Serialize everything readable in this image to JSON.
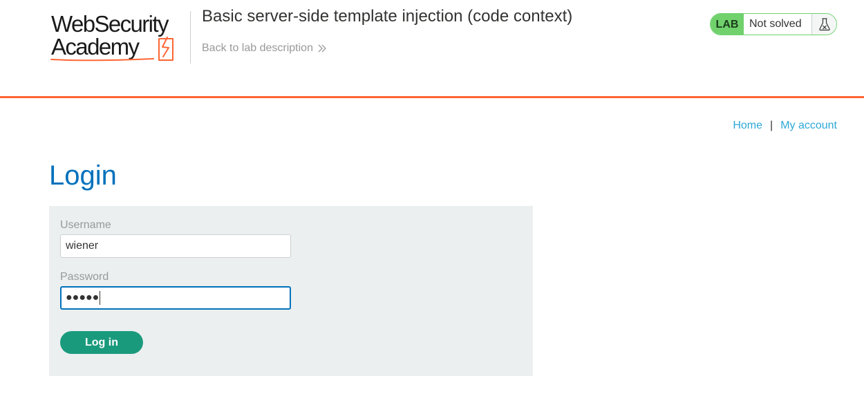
{
  "logo": {
    "line1": "WebSecurity",
    "line2": "Academy",
    "brand_color": "#ff6633"
  },
  "header": {
    "lab_title": "Basic server-side template injection (code context)",
    "back_link": "Back to lab description",
    "back_icon": "double-chevron-right-icon"
  },
  "status": {
    "tag": "LAB",
    "text": "Not solved",
    "icon": "flask-icon",
    "accent": "#70d16d"
  },
  "nav": {
    "home": "Home",
    "separator": "|",
    "my_account": "My account"
  },
  "login": {
    "title": "Login",
    "username_label": "Username",
    "username_value": "wiener",
    "password_label": "Password",
    "password_masked": "●●●●●",
    "submit_label": "Log in"
  },
  "colors": {
    "title_blue": "#0071bc",
    "link_blue": "#2ea8d6",
    "button_green": "#1a9a7d",
    "panel_bg": "#ebeff0"
  }
}
